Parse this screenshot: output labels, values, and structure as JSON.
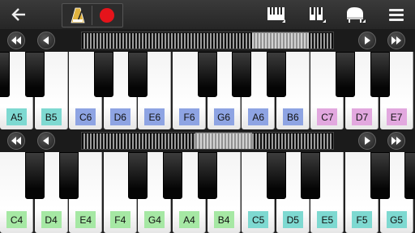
{
  "toolbar": {
    "back_icon": "arrow-left-icon",
    "metronome_icon": "metronome-icon",
    "record_icon": "record-icon",
    "record_color": "#e5141b",
    "keyboard_mode_icon": "keyboard-layout-icon",
    "dual_icon": "dual-keyboard-icon",
    "instrument_icon": "grand-piano-icon",
    "menu_icon": "hamburger-menu-icon"
  },
  "upper_keyboard": {
    "labels": [
      "A5",
      "B5",
      "C6",
      "D6",
      "E6",
      "F6",
      "G6",
      "A6",
      "B6",
      "C7",
      "D7",
      "E7"
    ],
    "colors": [
      "#7ed9d1",
      "#7ed9d1",
      "#8ea4e3",
      "#8ea4e3",
      "#8ea4e3",
      "#8ea4e3",
      "#8ea4e3",
      "#8ea4e3",
      "#8ea4e3",
      "#e2a8df",
      "#e2a8df",
      "#e2a8df"
    ]
  },
  "lower_keyboard": {
    "labels": [
      "C4",
      "D4",
      "E4",
      "F4",
      "G4",
      "A4",
      "B4",
      "C5",
      "D5",
      "E5",
      "F5",
      "G5"
    ],
    "colors": [
      "#a6e8a4",
      "#a6e8a4",
      "#a6e8a4",
      "#a6e8a4",
      "#a6e8a4",
      "#a6e8a4",
      "#a6e8a4",
      "#7ed9d1",
      "#7ed9d1",
      "#7ed9d1",
      "#7ed9d1",
      "#7ed9d1"
    ]
  },
  "nav_icons": {
    "fast_rewind": "fast-rewind-icon",
    "rewind": "rewind-icon",
    "forward": "play-forward-icon",
    "fast_forward": "fast-forward-icon"
  }
}
